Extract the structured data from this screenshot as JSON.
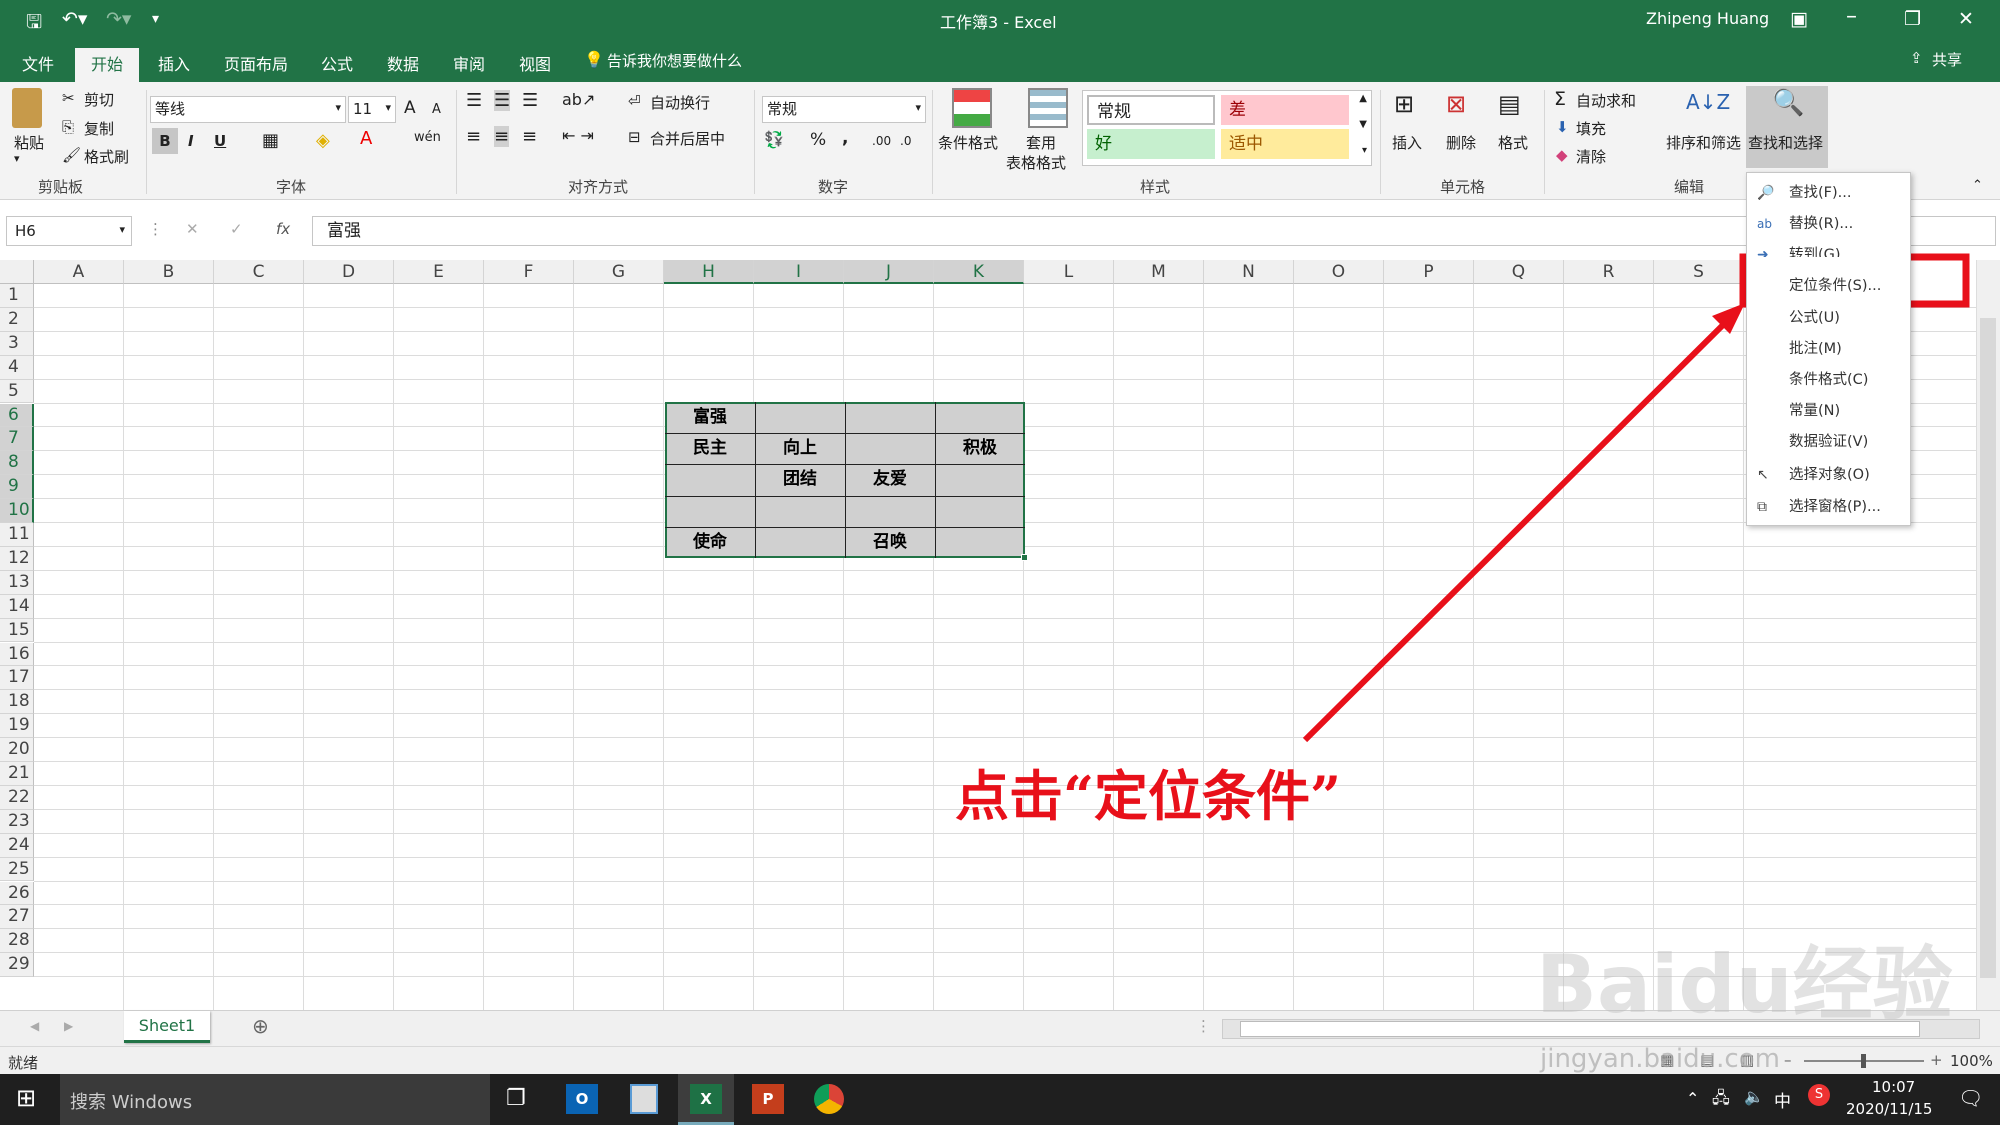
{
  "window": {
    "title": "工作簿3  -  Excel",
    "user": "Zhipeng Huang"
  },
  "tabs": [
    "文件",
    "开始",
    "插入",
    "页面布局",
    "公式",
    "数据",
    "审阅",
    "视图"
  ],
  "tell_me": "告诉我你想要做什么",
  "share": "共享",
  "ribbon": {
    "clipboard": {
      "paste": "粘贴",
      "cut": "剪切",
      "copy": "复制",
      "format_painter": "格式刷",
      "label": "剪贴板"
    },
    "font": {
      "name": "等线",
      "size": "11",
      "bold": "B",
      "italic": "I",
      "underline": "U",
      "grow": "A",
      "shrink": "A",
      "label": "字体"
    },
    "alignment": {
      "wrap": "自动换行",
      "merge": "合并后居中",
      "label": "对齐方式"
    },
    "number": {
      "format": "常规",
      "percent": "%",
      "comma": ",",
      "label": "数字"
    },
    "styles": {
      "cond_format": "条件格式",
      "table_format_1": "套用",
      "table_format_2": "表格格式",
      "normal": "常规",
      "bad": "差",
      "good": "好",
      "neutral": "适中",
      "label": "样式"
    },
    "cells": {
      "insert": "插入",
      "delete": "删除",
      "format": "格式",
      "label": "单元格"
    },
    "editing": {
      "autosum": "自动求和",
      "fill": "填充",
      "clear": "清除",
      "sort_filter": "排序和筛选",
      "find_select": "查找和选择",
      "label": "编辑"
    }
  },
  "formula_bar": {
    "name_box": "H6",
    "fx": "fx",
    "cancel": "✕",
    "enter": "✓",
    "content": "富强"
  },
  "columns": [
    "A",
    "B",
    "C",
    "D",
    "E",
    "F",
    "G",
    "H",
    "I",
    "J",
    "K",
    "L",
    "M",
    "N",
    "O",
    "P",
    "Q",
    "R",
    "S"
  ],
  "rows": [
    "1",
    "2",
    "3",
    "4",
    "5",
    "6",
    "7",
    "8",
    "9",
    "10",
    "11",
    "12",
    "13",
    "14",
    "15",
    "16",
    "17",
    "18",
    "19",
    "20",
    "21",
    "22",
    "23",
    "24",
    "25",
    "26",
    "27",
    "28",
    "29"
  ],
  "cells": {
    "H6": "富强",
    "H7": "民主",
    "I7": "向上",
    "K7": "积极",
    "I8": "团结",
    "J8": "友爱",
    "H10": "使命",
    "J10": "召唤"
  },
  "dropdown": {
    "items": [
      "查找(F)...",
      "替换(R)...",
      "转到(G)...",
      "定位条件(S)...",
      "公式(U)",
      "批注(M)",
      "条件格式(C)",
      "常量(N)",
      "数据验证(V)",
      "选择对象(O)",
      "选择窗格(P)..."
    ]
  },
  "annotation": "点击“定位条件”",
  "sheet": {
    "tab": "Sheet1"
  },
  "status": {
    "ready": "就绪",
    "zoom": "100%"
  },
  "taskbar": {
    "search": "搜索 Windows",
    "time": "10:07",
    "date": "2020/11/15",
    "lang": "中"
  },
  "watermark": {
    "text": "Baidu经验",
    "url": "jingyan.baidu.com"
  },
  "colors": {
    "excel_green": "#217346",
    "highlight_red": "#e8101a",
    "bad_fill": "#ffc7ce",
    "good_fill": "#c6efce",
    "neutral_fill": "#ffeb9c",
    "range_fill": "#d0d0d0"
  }
}
